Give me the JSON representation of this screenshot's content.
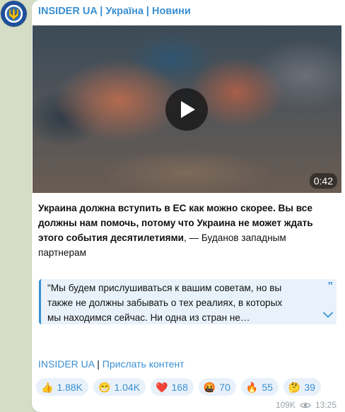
{
  "channel": {
    "name": "INSIDER UA | Україна | Новини"
  },
  "video": {
    "duration": "0:42"
  },
  "post": {
    "bold_text": "Украина должна вступить в ЕС как можно скорее. Вы все должны нам помочь, потому что Украина не может ждать этого события десятилетиями",
    "plain_text": ", — Буданов западным партнерам"
  },
  "quote": {
    "text": "\"Мы будем прислушиваться к вашим советам, но вы также не должны забывать о тех реалиях, в которых мы находимся сейчас. Ни одна из стран не…",
    "mark": "”"
  },
  "links": {
    "channel": "INSIDER UA",
    "separator": " | ",
    "submit": "Прислать контент"
  },
  "reactions": [
    {
      "emoji": "👍",
      "count": "1.88K"
    },
    {
      "emoji": "😁",
      "count": "1.04K"
    },
    {
      "emoji": "❤️",
      "count": "168"
    },
    {
      "emoji": "🤬",
      "count": "70"
    },
    {
      "emoji": "🔥",
      "count": "55"
    },
    {
      "emoji": "🤔",
      "count": "39"
    }
  ],
  "meta": {
    "views": "109K",
    "time": "13:25"
  },
  "colors": {
    "accent": "#3a8fd1",
    "background": "#d5ddc6",
    "quote_bg": "#e9f2fb"
  },
  "icons": [
    "trident-avatar",
    "play-icon",
    "quote-mark-icon",
    "chevron-down-icon",
    "eye-icon"
  ]
}
